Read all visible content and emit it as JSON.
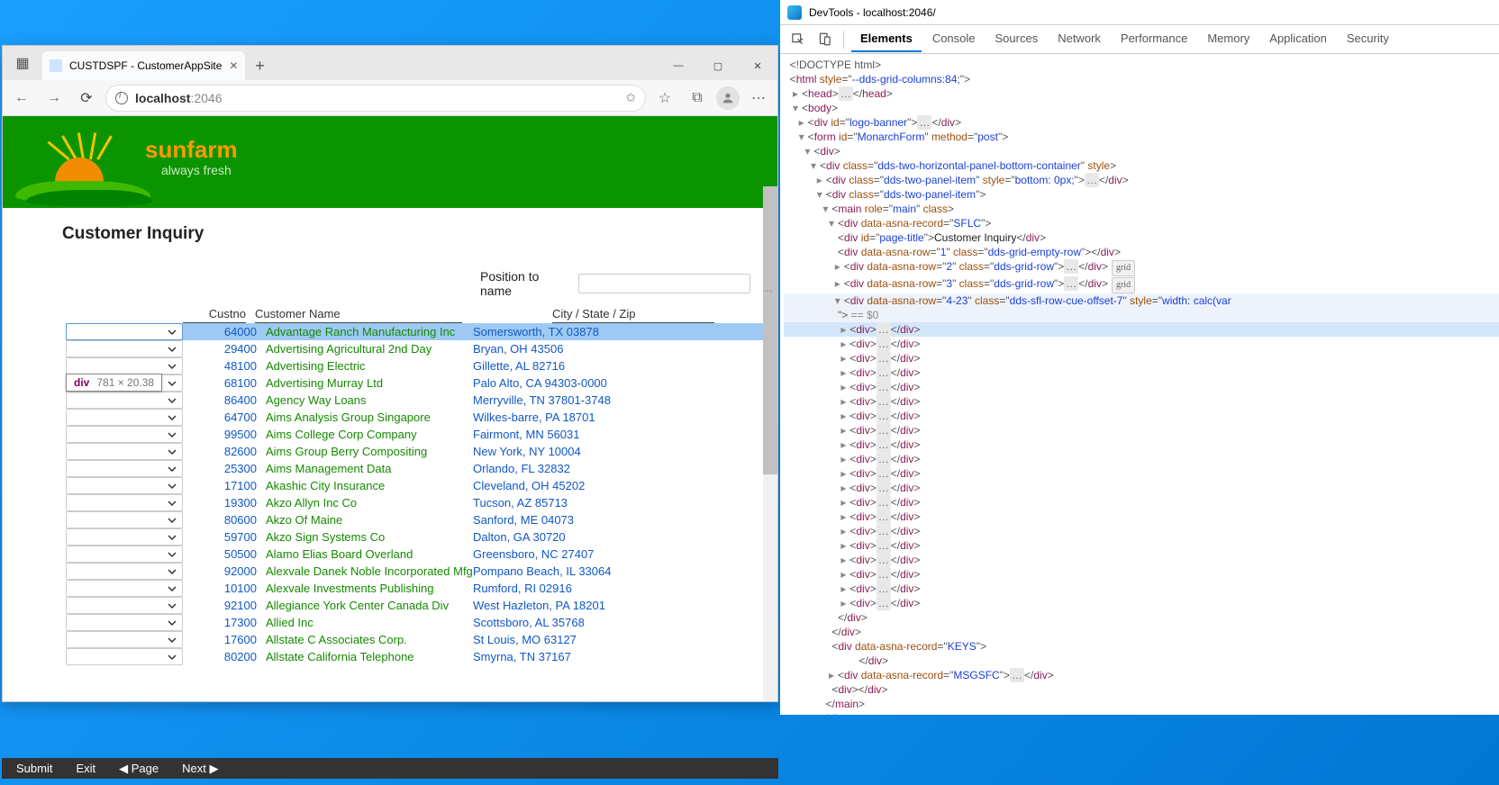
{
  "browser": {
    "tab_title": "CUSTDSPF - CustomerAppSite",
    "url_host": "localhost",
    "url_port": ":2046"
  },
  "win": {
    "min": "—",
    "max": "▢",
    "close": "✕"
  },
  "brand": {
    "name": "sunfarm",
    "tag": "always fresh"
  },
  "page_title": "Customer Inquiry",
  "position_label": "Position to name",
  "tooltip": {
    "tag": "div",
    "dim": "781 × 20.38"
  },
  "columns": {
    "custno": "Custno",
    "name": "Customer Name",
    "city": "City / State / Zip"
  },
  "rows": [
    {
      "custno": "64000",
      "name": "Advantage Ranch Manufacturing Inc",
      "city": "Somersworth, TX 03878",
      "selected": true
    },
    {
      "custno": "29400",
      "name": "Advertising Agricultural 2nd Day",
      "city": "Bryan, OH 43506"
    },
    {
      "custno": "48100",
      "name": "Advertising Electric",
      "city": "Gillette, AL 82716"
    },
    {
      "custno": "68100",
      "name": "Advertising Murray Ltd",
      "city": "Palo Alto, CA 94303-0000"
    },
    {
      "custno": "86400",
      "name": "Agency Way Loans",
      "city": "Merryville, TN 37801-3748"
    },
    {
      "custno": "64700",
      "name": "Aims Analysis Group Singapore",
      "city": "Wilkes-barre, PA 18701"
    },
    {
      "custno": "99500",
      "name": "Aims College Corp Company",
      "city": "Fairmont, MN 56031"
    },
    {
      "custno": "82600",
      "name": "Aims Group Berry Compositing",
      "city": "New York, NY 10004"
    },
    {
      "custno": "25300",
      "name": "Aims Management Data",
      "city": "Orlando, FL 32832"
    },
    {
      "custno": "17100",
      "name": "Akashic City Insurance",
      "city": "Cleveland, OH 45202"
    },
    {
      "custno": "19300",
      "name": "Akzo Allyn Inc Co",
      "city": "Tucson, AZ 85713"
    },
    {
      "custno": "80600",
      "name": "Akzo Of Maine",
      "city": "Sanford, ME 04073"
    },
    {
      "custno": "59700",
      "name": "Akzo Sign Systems Co",
      "city": "Dalton, GA 30720"
    },
    {
      "custno": "50500",
      "name": "Alamo Elias Board Overland",
      "city": "Greensboro, NC 27407"
    },
    {
      "custno": "92000",
      "name": "Alexvale Danek Noble Incorporated Mfg",
      "city": "Pompano Beach, IL 33064"
    },
    {
      "custno": "10100",
      "name": "Alexvale Investments Publishing",
      "city": "Rumford, RI 02916"
    },
    {
      "custno": "92100",
      "name": "Allegiance York Center Canada Div",
      "city": "West Hazleton, PA 18201"
    },
    {
      "custno": "17300",
      "name": "Allied Inc",
      "city": "Scottsboro, AL 35768"
    },
    {
      "custno": "17600",
      "name": "Allstate C Associates Corp.",
      "city": "St Louis, MO 63127"
    },
    {
      "custno": "80200",
      "name": "Allstate California Telephone",
      "city": "Smyrna, TN 37167"
    }
  ],
  "footer": {
    "submit": "Submit",
    "exit": "Exit",
    "page": "Page",
    "next": "Next"
  },
  "devtools": {
    "title": "DevTools - localhost:2046/",
    "tabs": [
      "Elements",
      "Console",
      "Sources",
      "Network",
      "Performance",
      "Memory",
      "Application",
      "Security"
    ],
    "active_tab": "Elements",
    "mark": "== $0"
  }
}
